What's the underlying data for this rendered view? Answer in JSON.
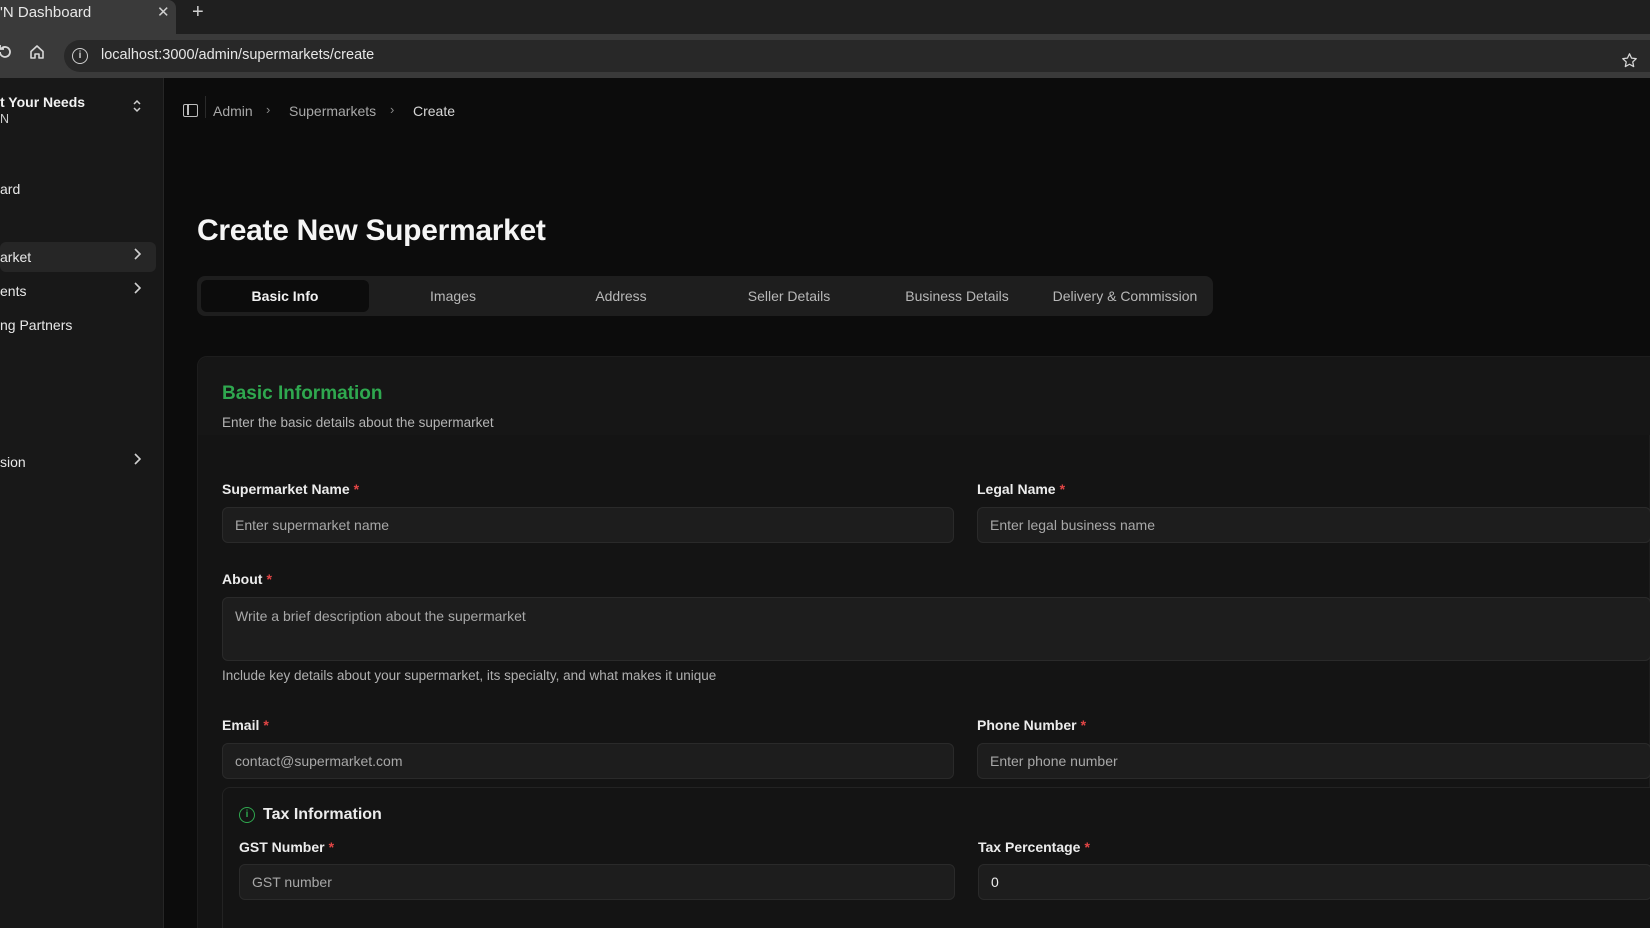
{
  "browser": {
    "tab_title": "'N Dashboard",
    "close_glyph": "✕",
    "new_tab_glyph": "+",
    "url": "localhost:3000/admin/supermarkets/create"
  },
  "sidebar": {
    "org_name": "t Your Needs",
    "org_sub": "N",
    "items": [
      {
        "label": "ard"
      },
      {
        "label": "arket"
      },
      {
        "label": "ents"
      },
      {
        "label": "ng Partners"
      },
      {
        "label": "sion"
      }
    ]
  },
  "breadcrumb": [
    "Admin",
    "Supermarkets",
    "Create"
  ],
  "page_title": "Create New Supermarket",
  "tabs": [
    "Basic Info",
    "Images",
    "Address",
    "Seller Details",
    "Business Details",
    "Delivery & Commission"
  ],
  "active_tab": "Basic Info",
  "section": {
    "title": "Basic Information",
    "description": "Enter the basic details about the supermarket"
  },
  "fields": {
    "supermarket_name": {
      "label": "Supermarket Name",
      "placeholder": "Enter supermarket name"
    },
    "legal_name": {
      "label": "Legal Name",
      "placeholder": "Enter legal business name"
    },
    "about": {
      "label": "About",
      "placeholder": "Write a brief description about the supermarket",
      "hint": "Include key details about your supermarket, its specialty, and what makes it unique"
    },
    "email": {
      "label": "Email",
      "placeholder": "contact@supermarket.com"
    },
    "phone": {
      "label": "Phone Number",
      "placeholder": "Enter phone number"
    }
  },
  "tax": {
    "title": "Tax Information",
    "gst": {
      "label": "GST Number",
      "placeholder": "GST number"
    },
    "percentage": {
      "label": "Tax Percentage",
      "value": "0"
    }
  },
  "required_mark": "*",
  "colors": {
    "accent_green": "#2fa84f",
    "required_red": "#e24545"
  }
}
